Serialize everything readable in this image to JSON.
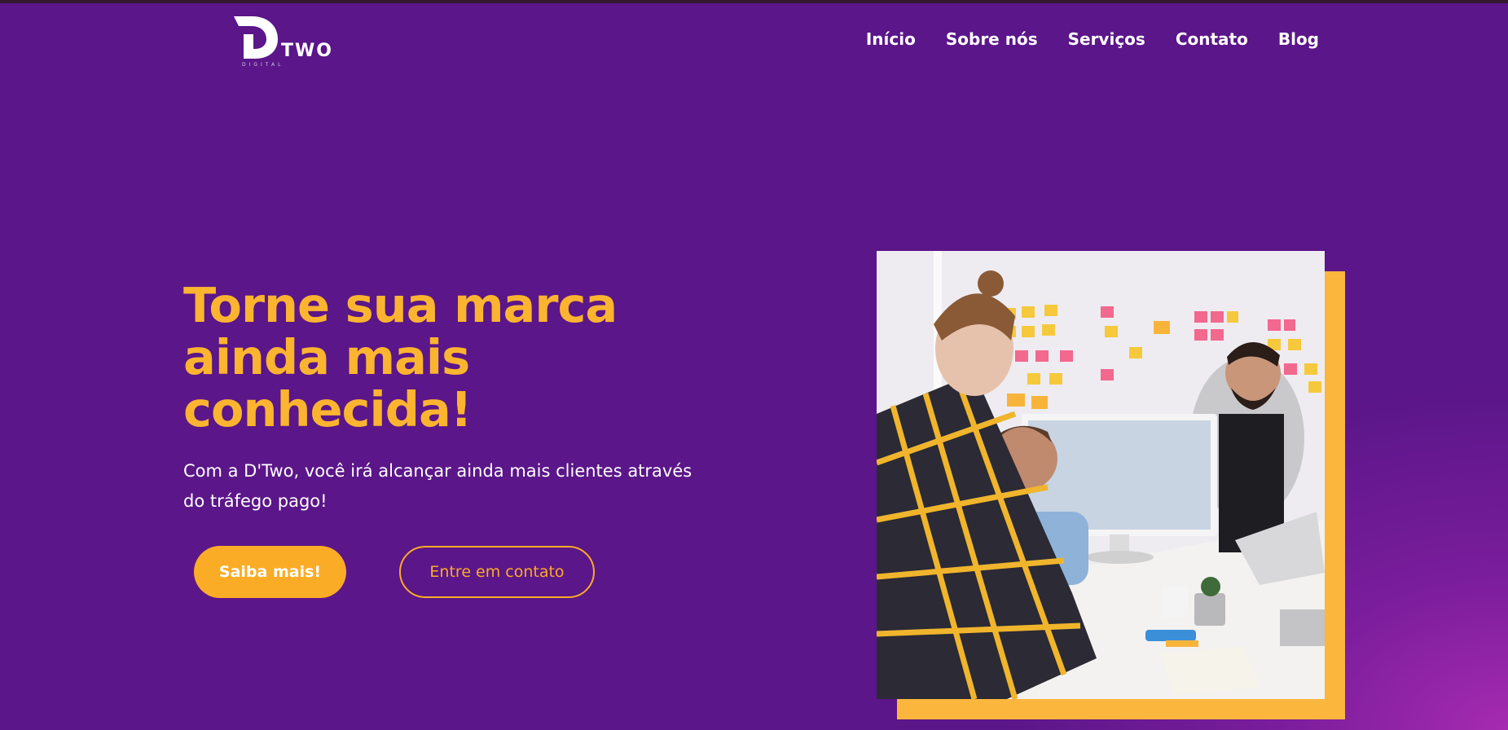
{
  "brand": {
    "name": "TWO",
    "tagline": "DIGITAL"
  },
  "nav": {
    "items": [
      "Início",
      "Sobre nós",
      "Serviços",
      "Contato",
      "Blog"
    ]
  },
  "hero": {
    "title": "Torne sua marca ainda mais conhecida!",
    "subtitle": "Com a D'Two, você irá alcançar ainda mais clientes através do tráfego pago!",
    "primary_button": "Saiba mais!",
    "secondary_button": "Entre em contato",
    "image_icon": "office-team-meeting-photo"
  },
  "colors": {
    "background": "#5b1689",
    "accent": "#fbac26",
    "title": "#fbb42f",
    "text": "#ffffff"
  }
}
